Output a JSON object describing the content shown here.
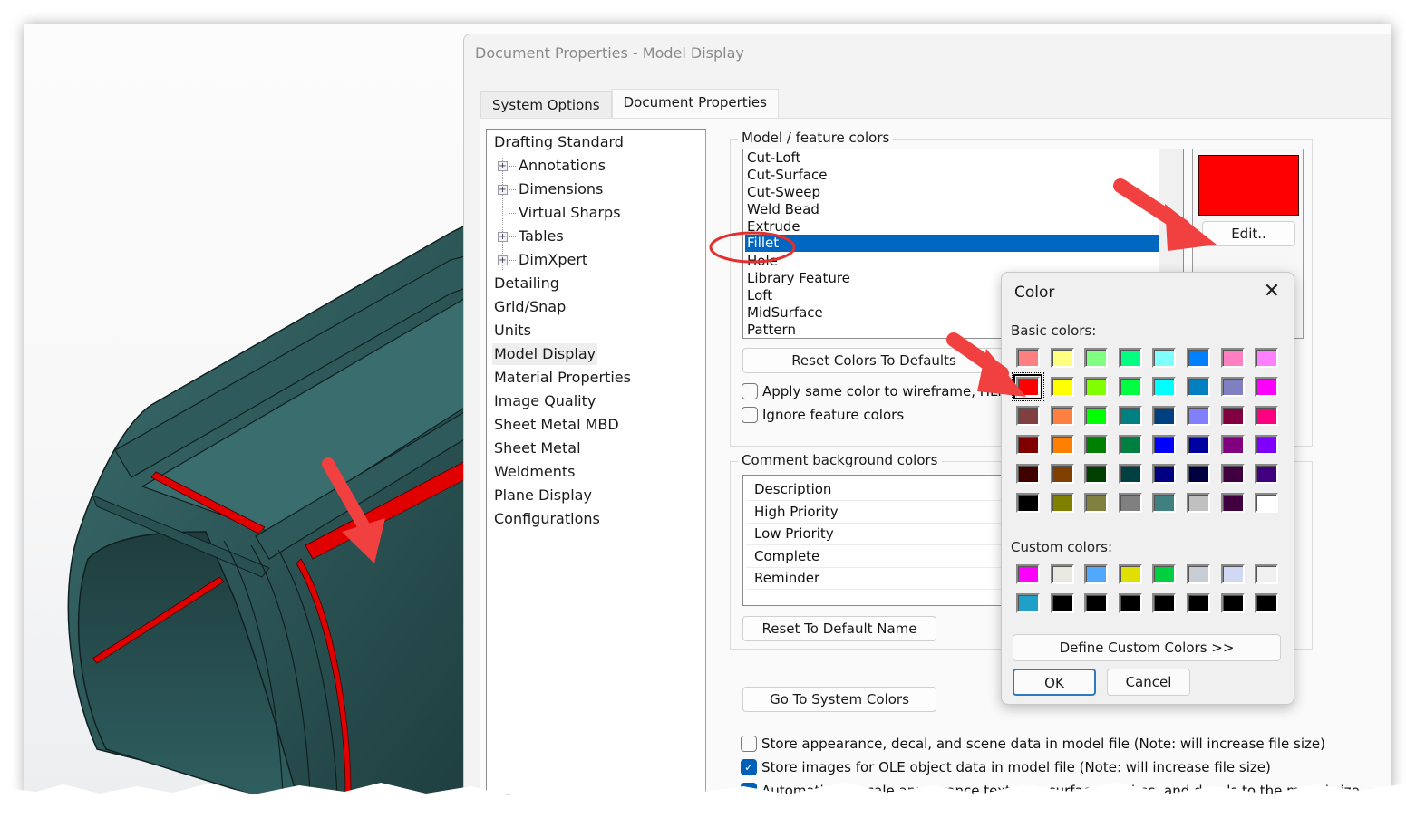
{
  "dialog": {
    "title": "Document Properties - Model Display",
    "tabs": [
      {
        "label": "System Options",
        "active": false
      },
      {
        "label": "Document Properties",
        "active": true
      }
    ]
  },
  "tree": {
    "items": [
      {
        "label": "Drafting Standard",
        "level": 0
      },
      {
        "label": "Annotations",
        "level": 1,
        "expandable": true
      },
      {
        "label": "Dimensions",
        "level": 1,
        "expandable": true
      },
      {
        "label": "Virtual Sharps",
        "level": 1,
        "expandable": false
      },
      {
        "label": "Tables",
        "level": 1,
        "expandable": true
      },
      {
        "label": "DimXpert",
        "level": 1,
        "expandable": true
      },
      {
        "label": "Detailing",
        "level": 0
      },
      {
        "label": "Grid/Snap",
        "level": 0
      },
      {
        "label": "Units",
        "level": 0
      },
      {
        "label": "Model Display",
        "level": 0,
        "selected": true
      },
      {
        "label": "Material Properties",
        "level": 0
      },
      {
        "label": "Image Quality",
        "level": 0
      },
      {
        "label": "Sheet Metal MBD",
        "level": 0
      },
      {
        "label": "Sheet Metal",
        "level": 0
      },
      {
        "label": "Weldments",
        "level": 0
      },
      {
        "label": "Plane Display",
        "level": 0
      },
      {
        "label": "Configurations",
        "level": 0
      }
    ]
  },
  "model_colors": {
    "group_label": "Model / feature colors",
    "items": [
      "Cut-Loft",
      "Cut-Surface",
      "Cut-Sweep",
      "Weld Bead",
      "Extrude",
      "Fillet",
      "Hole",
      "Library Feature",
      "Loft",
      "MidSurface",
      "Pattern"
    ],
    "selected": "Fillet",
    "current_color": "#ff0000",
    "edit_label": "Edit..",
    "reset_label": "Reset Colors To Defaults",
    "apply_wireframe_label": "Apply same color to wireframe, HLR a",
    "apply_wireframe_checked": false,
    "ignore_label": "Ignore feature colors",
    "ignore_checked": false
  },
  "comment_colors": {
    "group_label": "Comment background colors",
    "items": [
      "Description",
      "High Priority",
      "Low Priority",
      "Complete",
      "Reminder"
    ],
    "reset_name_label": "Reset To Default Name"
  },
  "system_colors_label": "Go To System Colors",
  "options": [
    {
      "label": "Store appearance, decal, and scene data in model file (Note: will increase file size)",
      "checked": false
    },
    {
      "label": "Store images for OLE object data in model file (Note: will increase file size)",
      "checked": true
    },
    {
      "label": "Automatically scale appearance textures, surface finishes, and decals to the model size",
      "checked": true
    }
  ],
  "color_dialog": {
    "title": "Color",
    "close_icon": "close-icon",
    "basic_label": "Basic colors:",
    "basic_colors": [
      [
        "#ff8080",
        "#ffff80",
        "#80ff80",
        "#00ff80",
        "#80ffff",
        "#0080ff",
        "#ff80c0",
        "#ff80ff"
      ],
      [
        "#ff0000",
        "#ffff00",
        "#80ff00",
        "#00ff40",
        "#00ffff",
        "#0080c0",
        "#8080c0",
        "#ff00ff"
      ],
      [
        "#804040",
        "#ff8040",
        "#00ff00",
        "#008080",
        "#004080",
        "#8080ff",
        "#800040",
        "#ff0080"
      ],
      [
        "#800000",
        "#ff8000",
        "#008000",
        "#008040",
        "#0000ff",
        "#0000a0",
        "#800080",
        "#8000ff"
      ],
      [
        "#400000",
        "#804000",
        "#004000",
        "#004040",
        "#000080",
        "#000040",
        "#400040",
        "#400080"
      ],
      [
        "#000000",
        "#808000",
        "#808040",
        "#808080",
        "#408080",
        "#c0c0c0",
        "#400040",
        "#ffffff"
      ]
    ],
    "selected_basic": [
      1,
      0
    ],
    "custom_label": "Custom colors:",
    "custom_colors": [
      [
        "#ff00ff",
        "#e8e8e0",
        "#50a8ff",
        "#e0e000",
        "#00d040",
        "#c8ccd4",
        "#d0d8f4",
        "#f0f0f0"
      ],
      [
        "#20a0c8",
        "#000000",
        "#000000",
        "#000000",
        "#000000",
        "#000000",
        "#000000",
        "#000000"
      ]
    ],
    "define_custom_label": "Define Custom Colors >>",
    "ok_label": "OK",
    "cancel_label": "Cancel"
  },
  "annotation_color": "#f04040"
}
